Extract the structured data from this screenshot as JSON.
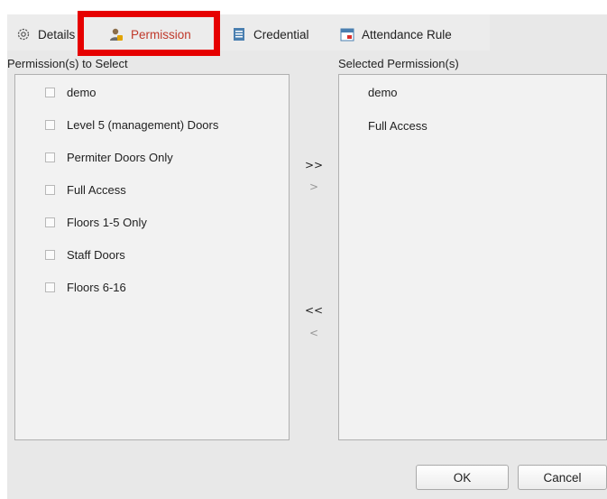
{
  "tabs": [
    {
      "label": "Details",
      "icon": "gear-icon"
    },
    {
      "label": "Permission",
      "icon": "user-lock-icon",
      "active": true
    },
    {
      "label": "Credential",
      "icon": "credential-card-icon"
    },
    {
      "label": "Attendance Rule",
      "icon": "calendar-icon"
    }
  ],
  "available": {
    "label": "Permission(s) to Select",
    "items": [
      "demo",
      "Level 5 (management) Doors",
      "Permiter Doors Only",
      "Full Access",
      "Floors 1-5 Only",
      "Staff Doors",
      "Floors 6-16"
    ]
  },
  "selected": {
    "label": "Selected Permission(s)",
    "items": [
      "demo",
      "Full Access"
    ]
  },
  "arrows": {
    "add_all": ">>",
    "add": ">",
    "remove_all": "<<",
    "remove": "<"
  },
  "buttons": {
    "ok": "OK",
    "cancel": "Cancel"
  },
  "colors": {
    "active_tab": "#c0392b",
    "highlight": "#e60000"
  }
}
